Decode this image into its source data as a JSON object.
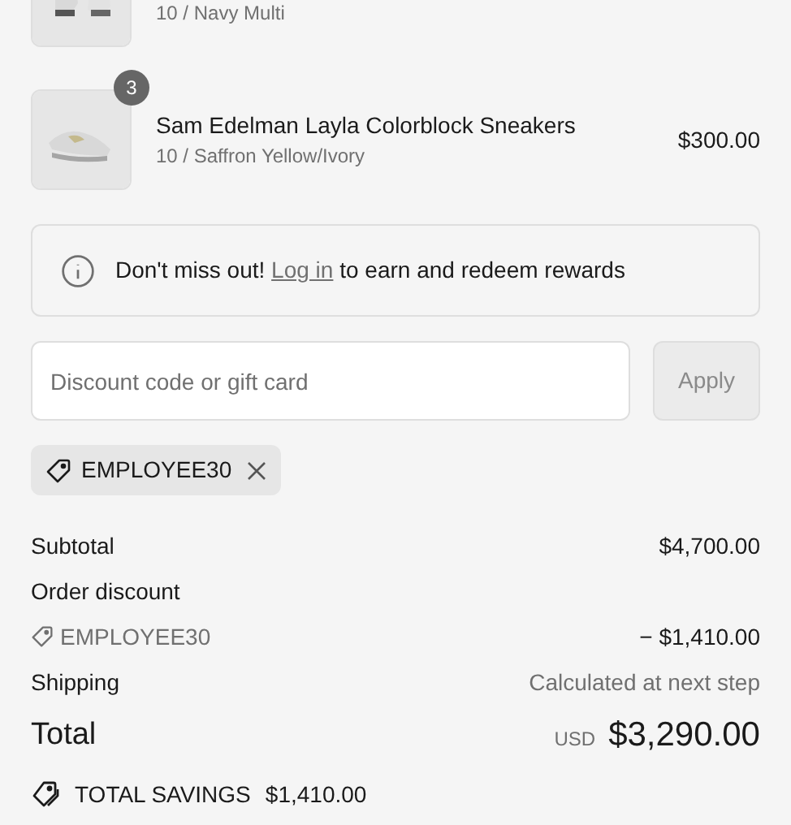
{
  "items": [
    {
      "variant": "10 / Navy Multi",
      "cut": true
    },
    {
      "quantity": "3",
      "name": "Sam Edelman Layla Colorblock Sneakers",
      "variant": "10 / Saffron Yellow/Ivory",
      "price": "$300.00",
      "cut": false
    }
  ],
  "notice": {
    "before": "Don't miss out!",
    "link": "Log in",
    "after": "to earn and redeem rewards"
  },
  "discount": {
    "placeholder": "Discount code or gift card",
    "button": "Apply",
    "disabled": true
  },
  "applied_codes": [
    "EMPLOYEE30"
  ],
  "summary": {
    "subtotal_label": "Subtotal",
    "subtotal": "$4,700.00",
    "discount_label": "Order discount",
    "discount_code": "EMPLOYEE30",
    "discount_amount": "− $1,410.00",
    "shipping_label": "Shipping",
    "shipping": "Calculated at next step",
    "total_label": "Total",
    "currency": "USD",
    "total": "$3,290.00",
    "savings_label": "TOTAL SAVINGS",
    "savings": "$1,410.00"
  }
}
